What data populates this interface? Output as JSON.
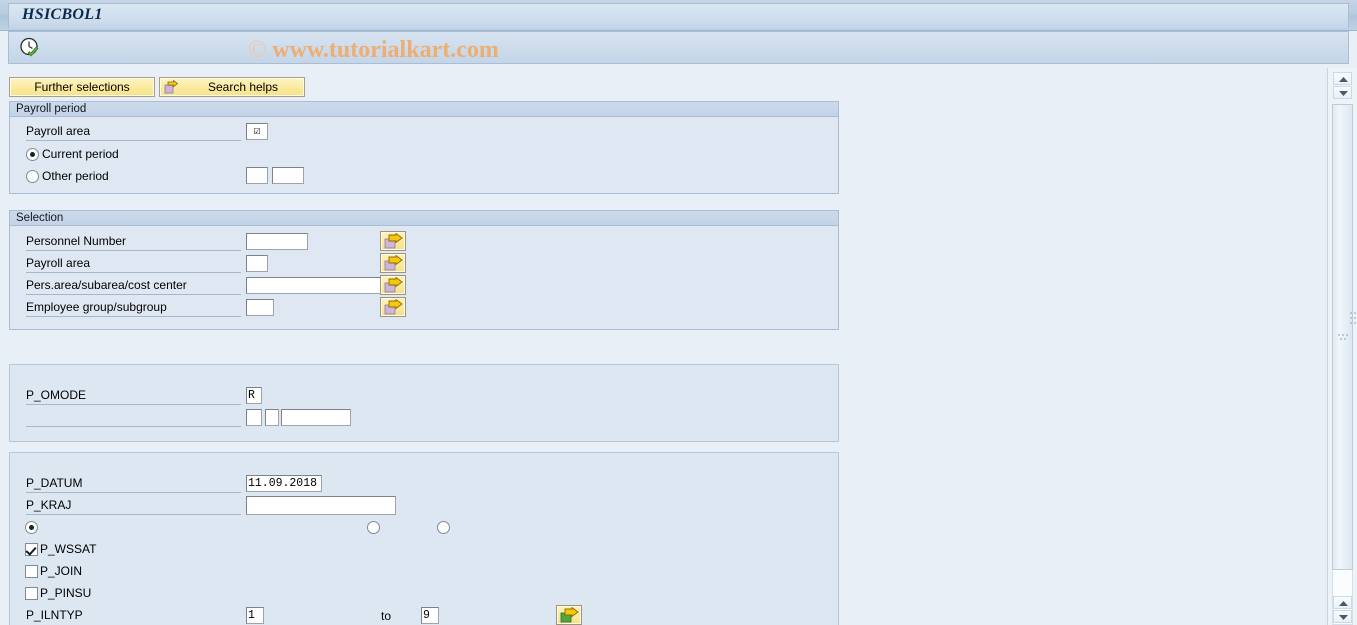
{
  "window": {
    "title": "HSICBOL1"
  },
  "toolbar": {
    "execute_icon": "clock-check-execute-icon",
    "watermark": "www.tutorialkart.com",
    "watermark_copyright": "©"
  },
  "buttons": {
    "further_selections": "Further selections",
    "search_helps": "Search helps",
    "search_helps_icon": "yellow-arrow-icon"
  },
  "payroll_period": {
    "group_title": "Payroll period",
    "payroll_area_label": "Payroll area",
    "payroll_area_value": "☑",
    "current_period_label": "Current period",
    "current_period_selected": true,
    "other_period_label": "Other period",
    "other_period_selected": false,
    "other_period_value_1": "",
    "other_period_value_2": ""
  },
  "selection": {
    "group_title": "Selection",
    "rows": [
      {
        "label": "Personnel Number",
        "value": "",
        "arrow_icon": "multiple-selection-arrow-icon"
      },
      {
        "label": "Payroll area",
        "value": "",
        "arrow_icon": "multiple-selection-arrow-icon"
      },
      {
        "label": "Pers.area/subarea/cost center",
        "value": "",
        "arrow_icon": "multiple-selection-arrow-icon"
      },
      {
        "label": "Employee group/subgroup",
        "value": "",
        "arrow_icon": "multiple-selection-arrow-icon"
      }
    ]
  },
  "omode_box": {
    "label": "P_OMODE",
    "value": "R",
    "sub_value_1": "",
    "sub_value_2": "",
    "sub_value_3": ""
  },
  "params_box": {
    "datum_label": "P_DATUM",
    "datum_value": "11.09.2018",
    "kraj_label": "P_KRAJ",
    "kraj_value": "",
    "radios": [
      {
        "name": "radio-option-1",
        "selected": true
      },
      {
        "name": "radio-option-2",
        "selected": false
      },
      {
        "name": "radio-option-3",
        "selected": false
      }
    ],
    "checkboxes": [
      {
        "label": "P_WSSAT",
        "checked": true
      },
      {
        "label": "P_JOIN",
        "checked": false
      },
      {
        "label": "P_PINSU",
        "checked": false
      }
    ],
    "ilntyp_label": "P_ILNTYP",
    "ilntyp_from": "1",
    "ilntyp_to_text": "to",
    "ilntyp_to": "9",
    "ilntyp_arrow_icon": "multiple-selection-arrow-green-icon"
  },
  "scrollbar": {
    "up_icon": "scroll-up-arrow-icon",
    "down_icon": "scroll-down-arrow-icon",
    "page_up_icon": "scroll-page-up-arrow-icon",
    "page_down_icon": "scroll-page-down-arrow-icon"
  },
  "colors": {
    "title_text": "#0b2a4a",
    "watermark": "#f0ab6b",
    "button_yellow": "#fbeba1",
    "group_bg": "#dfe8f2",
    "content_bg": "#e9eff6"
  }
}
